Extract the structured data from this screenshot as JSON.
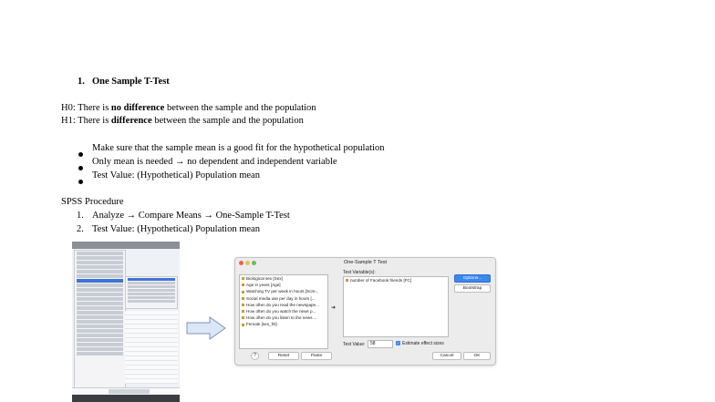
{
  "doc": {
    "heading_num": "1.",
    "heading": "One Sample T-Test",
    "h0_prefix": "H0: There is ",
    "h0_bold": "no difference",
    "h0_suffix": " between the sample and the population",
    "h1_prefix": "H1: There is ",
    "h1_bold": "difference",
    "h1_suffix": " between the sample and the population",
    "bullets": [
      "Make sure that the sample mean is a good fit for the hypothetical population",
      "Only mean is needed → no dependent and independent variable",
      "Test Value: (Hypothetical) Population mean"
    ],
    "procedure_title": "SPSS Procedure",
    "steps": [
      {
        "num": "1.",
        "text": "Analyze → Compare Means → One-Sample T-Test"
      },
      {
        "num": "2.",
        "text": "Test Value:  (Hypothetical) Population mean"
      }
    ]
  },
  "dialog": {
    "title": "One-Sample T Test",
    "variables": [
      "Biological sex [Sex]",
      "Age in years [Age]",
      "Watching TV per week in hours [Scre...",
      "Social media use per day in hours [...",
      "How often do you read the newspape...",
      "How often do you watch the news p...",
      "How often do you listen to the news ...",
      "Female [sex_fnl]"
    ],
    "test_variables_label": "Test Variable(s):",
    "test_variables": [
      "number of Facebook friends [FC]"
    ],
    "options_button": "Options...",
    "bootstrap_button": "Bootstrap",
    "test_value_label": "Test Value:",
    "test_value": "58",
    "effect_sizes_label": "Estimate effect sizes",
    "help_label": "?",
    "reset_button": "Reset",
    "paste_button": "Paste",
    "cancel_button": "Cancel",
    "ok_button": "OK"
  },
  "colors": {
    "accent": "#3c87f0",
    "dialog_bg": "#ececec"
  }
}
